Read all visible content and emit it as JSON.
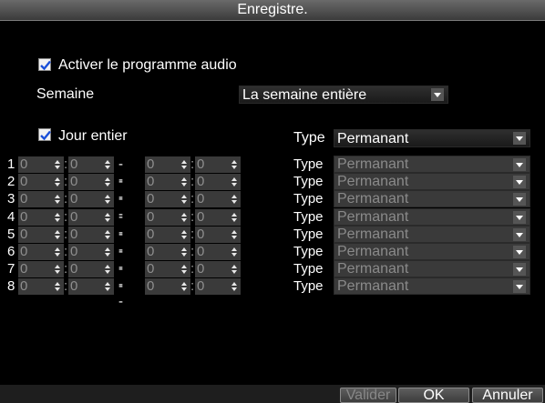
{
  "title": "Enregistre.",
  "audio": {
    "label": "Activer le programme audio",
    "checked": true
  },
  "week": {
    "label": "Semaine",
    "value": "La semaine entière"
  },
  "allday": {
    "label": "Jour entier",
    "checked": true,
    "type_label": "Type",
    "type_value": "Permanant"
  },
  "rows": [
    {
      "num": "1",
      "h1": "0",
      "m1": "0",
      "sep": "--",
      "h2": "0",
      "m2": "0",
      "type_label": "Type",
      "type_value": "Permanant"
    },
    {
      "num": "2",
      "h1": "0",
      "m1": "0",
      "sep": "--",
      "h2": "0",
      "m2": "0",
      "type_label": "Type",
      "type_value": "Permanant"
    },
    {
      "num": "3",
      "h1": "0",
      "m1": "0",
      "sep": "--",
      "h2": "0",
      "m2": "0",
      "type_label": "Type",
      "type_value": "Permanant"
    },
    {
      "num": "4",
      "h1": "0",
      "m1": "0",
      "sep": "--",
      "h2": "0",
      "m2": "0",
      "type_label": "Type",
      "type_value": "Permanant"
    },
    {
      "num": "5",
      "h1": "0",
      "m1": "0",
      "sep": "--",
      "h2": "0",
      "m2": "0",
      "type_label": "Type",
      "type_value": "Permanant"
    },
    {
      "num": "6",
      "h1": "0",
      "m1": "0",
      "sep": "--",
      "h2": "0",
      "m2": "0",
      "type_label": "Type",
      "type_value": "Permanant"
    },
    {
      "num": "7",
      "h1": "0",
      "m1": "0",
      "sep": "--",
      "h2": "0",
      "m2": "0",
      "type_label": "Type",
      "type_value": "Permanant"
    },
    {
      "num": "8",
      "h1": "0",
      "m1": "0",
      "sep": "--",
      "h2": "0",
      "m2": "0",
      "type_label": "Type",
      "type_value": "Permanant"
    }
  ],
  "colon": ":",
  "buttons": {
    "validate": "Valider",
    "ok": "OK",
    "cancel": "Annuler"
  }
}
